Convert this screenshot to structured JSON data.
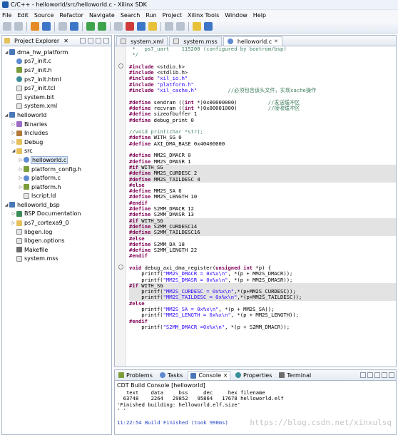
{
  "window": {
    "title": "C/C++ - helloworld/src/helloworld.c - Xilinx SDK"
  },
  "menu": [
    "File",
    "Edit",
    "Source",
    "Refactor",
    "Navigate",
    "Search",
    "Run",
    "Project",
    "Xilinx Tools",
    "Window",
    "Help"
  ],
  "explorer": {
    "title": "Project Explorer",
    "items": [
      {
        "label": "dma_hw_platform",
        "level": 0,
        "expanded": true,
        "icon": "project-icon"
      },
      {
        "label": "ps7_init.c",
        "level": 1,
        "icon": "c-file-icon"
      },
      {
        "label": "ps7_init.h",
        "level": 1,
        "icon": "h-file-icon"
      },
      {
        "label": "ps7_init.html",
        "level": 1,
        "icon": "html-file-icon"
      },
      {
        "label": "ps7_init.tcl",
        "level": 1,
        "icon": "file-icon"
      },
      {
        "label": "system.bit",
        "level": 1,
        "icon": "file-icon"
      },
      {
        "label": "system.xml",
        "level": 1,
        "icon": "file-icon"
      },
      {
        "label": "helloworld",
        "level": 0,
        "expanded": true,
        "icon": "project-icon"
      },
      {
        "label": "Binaries",
        "level": 1,
        "collapsed": true,
        "icon": "binaries-icon"
      },
      {
        "label": "Includes",
        "level": 1,
        "collapsed": true,
        "icon": "includes-icon"
      },
      {
        "label": "Debug",
        "level": 1,
        "collapsed": true,
        "icon": "folder-icon"
      },
      {
        "label": "src",
        "level": 1,
        "expanded": true,
        "icon": "folder-icon"
      },
      {
        "label": "helloworld.c",
        "level": 2,
        "collapsed": true,
        "icon": "c-file-icon",
        "selected": true
      },
      {
        "label": "platform_config.h",
        "level": 2,
        "collapsed": true,
        "icon": "h-file-icon"
      },
      {
        "label": "platform.c",
        "level": 2,
        "collapsed": true,
        "icon": "c-file-icon"
      },
      {
        "label": "platform.h",
        "level": 2,
        "collapsed": true,
        "icon": "h-file-icon"
      },
      {
        "label": "lscript.ld",
        "level": 2,
        "icon": "file-icon"
      },
      {
        "label": "helloworld_bsp",
        "level": 0,
        "expanded": true,
        "icon": "project-icon"
      },
      {
        "label": "BSP Documentation",
        "level": 1,
        "collapsed": true,
        "icon": "doc-icon"
      },
      {
        "label": "ps7_cortexa9_0",
        "level": 1,
        "collapsed": true,
        "icon": "folder-icon"
      },
      {
        "label": "libgen.log",
        "level": 1,
        "icon": "file-icon"
      },
      {
        "label": "libgen.options",
        "level": 1,
        "icon": "file-icon"
      },
      {
        "label": "Makefile",
        "level": 1,
        "icon": "makefile-icon"
      },
      {
        "label": "system.mss",
        "level": 1,
        "icon": "file-icon"
      }
    ]
  },
  "editor": {
    "tabs": [
      {
        "label": "system.xml",
        "active": false
      },
      {
        "label": "system.mss",
        "active": false
      },
      {
        "label": "helloworld.c",
        "active": true
      }
    ],
    "code_lines": [
      " *   ps7_uart    115200 (configured by bootrom/bsp)",
      " */",
      "",
      "#include <stdio.h>",
      "#include <stdlib.h>",
      "#include \"xil_io.h\"",
      "#include \"platform.h\"",
      "#include \"xil_cache.h\"          //必须包含该头文件，实现cache操作",
      "",
      "#define sendram ((int *)0x00000000)          //发送缓冲区",
      "#define recvram ((int *)0x00001000)          //接收缓冲区",
      "#define sizeofbuffer 1",
      "#define debug_print 0",
      "",
      "//void print(char *str);",
      "#define WITH_SG 0",
      "#define AXI_DMA_BASE 0x40400000",
      "",
      "#define MM2S_DMACR 0",
      "#define MM2S_DMASR 1",
      "#if WITH_SG",
      "#define MM2S_CURDESC 2",
      "#define MM2S_TAILDESC 4",
      "#else",
      "#define MM2S_SA 6",
      "#define MM2S_LENGTH 10",
      "#endif",
      "#define S2MM_DMACR 12",
      "#define S2MM_DMASR 13",
      "#if WITH_SG",
      "#define S2MM_CURDESC14",
      "#define S2MM_TAILDESC16",
      "#else",
      "#define S2MM_DA 18",
      "#define S2MM_LENGTH 22",
      "#endif",
      "",
      "void debug_axi_dma_register(unsigned int *p) {",
      "    printf(\"MM2S_DMACR = 0x%x\\n\", *(p + MM2S_DMACR));",
      "    printf(\"MM2S_DMASR = 0x%x\\n\", *(p + MM2S_DMASR));",
      "#if WITH_SG",
      "    printf(\"MM2S_CURDESC = 0x%x\\n\",*(p+MM2S_CURDESC));",
      "    printf(\"MM2S_TAILDESC = 0x%x\\n\",*(p+MM2S_TAILDESC));",
      "#else",
      "    printf(\"MM2S_SA = 0x%x\\n\", *(p + MM2S_SA));",
      "    printf(\"MM2S_LENGTH = 0x%x\\n\", *(p + MM2S_LENGTH));",
      "#endif",
      "    printf(\"S2MM_DMACR =0x%x\\n\", *(p + S2MM_DMACR));"
    ],
    "highlighted_lines": [
      20,
      21,
      22,
      29,
      30,
      31,
      40,
      41,
      42
    ]
  },
  "console": {
    "tabs": [
      {
        "label": "Problems",
        "active": false
      },
      {
        "label": "Tasks",
        "active": false
      },
      {
        "label": "Console",
        "active": true
      },
      {
        "label": "Properties",
        "active": false
      },
      {
        "label": "Terminal",
        "active": false
      }
    ],
    "title": "CDT Build Console [helloworld]",
    "lines": [
      "   text    data     bss     dec     hex filename",
      "  63748    2264   29852   95864   17678 helloworld.elf",
      "'Finished building: helloworld.elf.size'",
      "' '"
    ],
    "build_finished": "11:22:54 Build Finished (took 990ms)",
    "watermark": "https://blog.csdn.net/xinxulsq"
  }
}
